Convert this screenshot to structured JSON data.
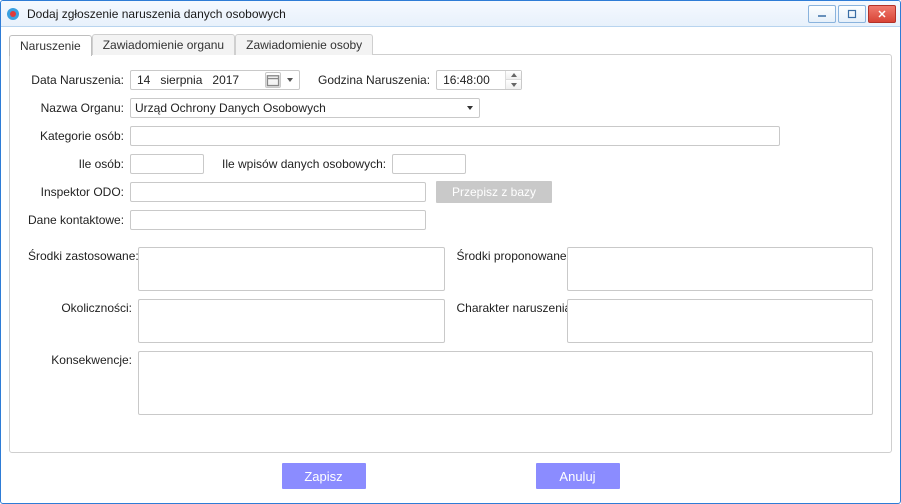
{
  "window": {
    "title": "Dodaj zgłoszenie naruszenia danych osobowych"
  },
  "tabs": [
    {
      "label": "Naruszenie",
      "active": true
    },
    {
      "label": "Zawiadomienie organu",
      "active": false
    },
    {
      "label": "Zawiadomienie osoby",
      "active": false
    }
  ],
  "form": {
    "date_label": "Data Naruszenia:",
    "date": {
      "day": "14",
      "month": "sierpnia",
      "year": "2017"
    },
    "time_label": "Godzina Naruszenia:",
    "time": "16:48:00",
    "authority_label": "Nazwa Organu:",
    "authority_value": "Urząd Ochrony Danych Osobowych",
    "categories_label": "Kategorie osób:",
    "categories_value": "",
    "people_count_label": "Ile osób:",
    "people_count_value": "",
    "records_count_label": "Ile wpisów danych osobowych:",
    "records_count_value": "",
    "inspector_label": "Inspektor ODO:",
    "inspector_value": "",
    "copy_from_db_btn": "Przepisz z bazy",
    "contact_label": "Dane kontaktowe:",
    "contact_value": "",
    "applied_label": "Środki zastosowane:",
    "applied_value": "",
    "proposed_label": "Środki proponowane:",
    "proposed_value": "",
    "circumstances_label": "Okoliczności:",
    "circumstances_value": "",
    "nature_label": "Charakter naruszenia:",
    "nature_value": "",
    "consequences_label": "Konsekwencje:",
    "consequences_value": ""
  },
  "footer": {
    "save": "Zapisz",
    "cancel": "Anuluj"
  }
}
